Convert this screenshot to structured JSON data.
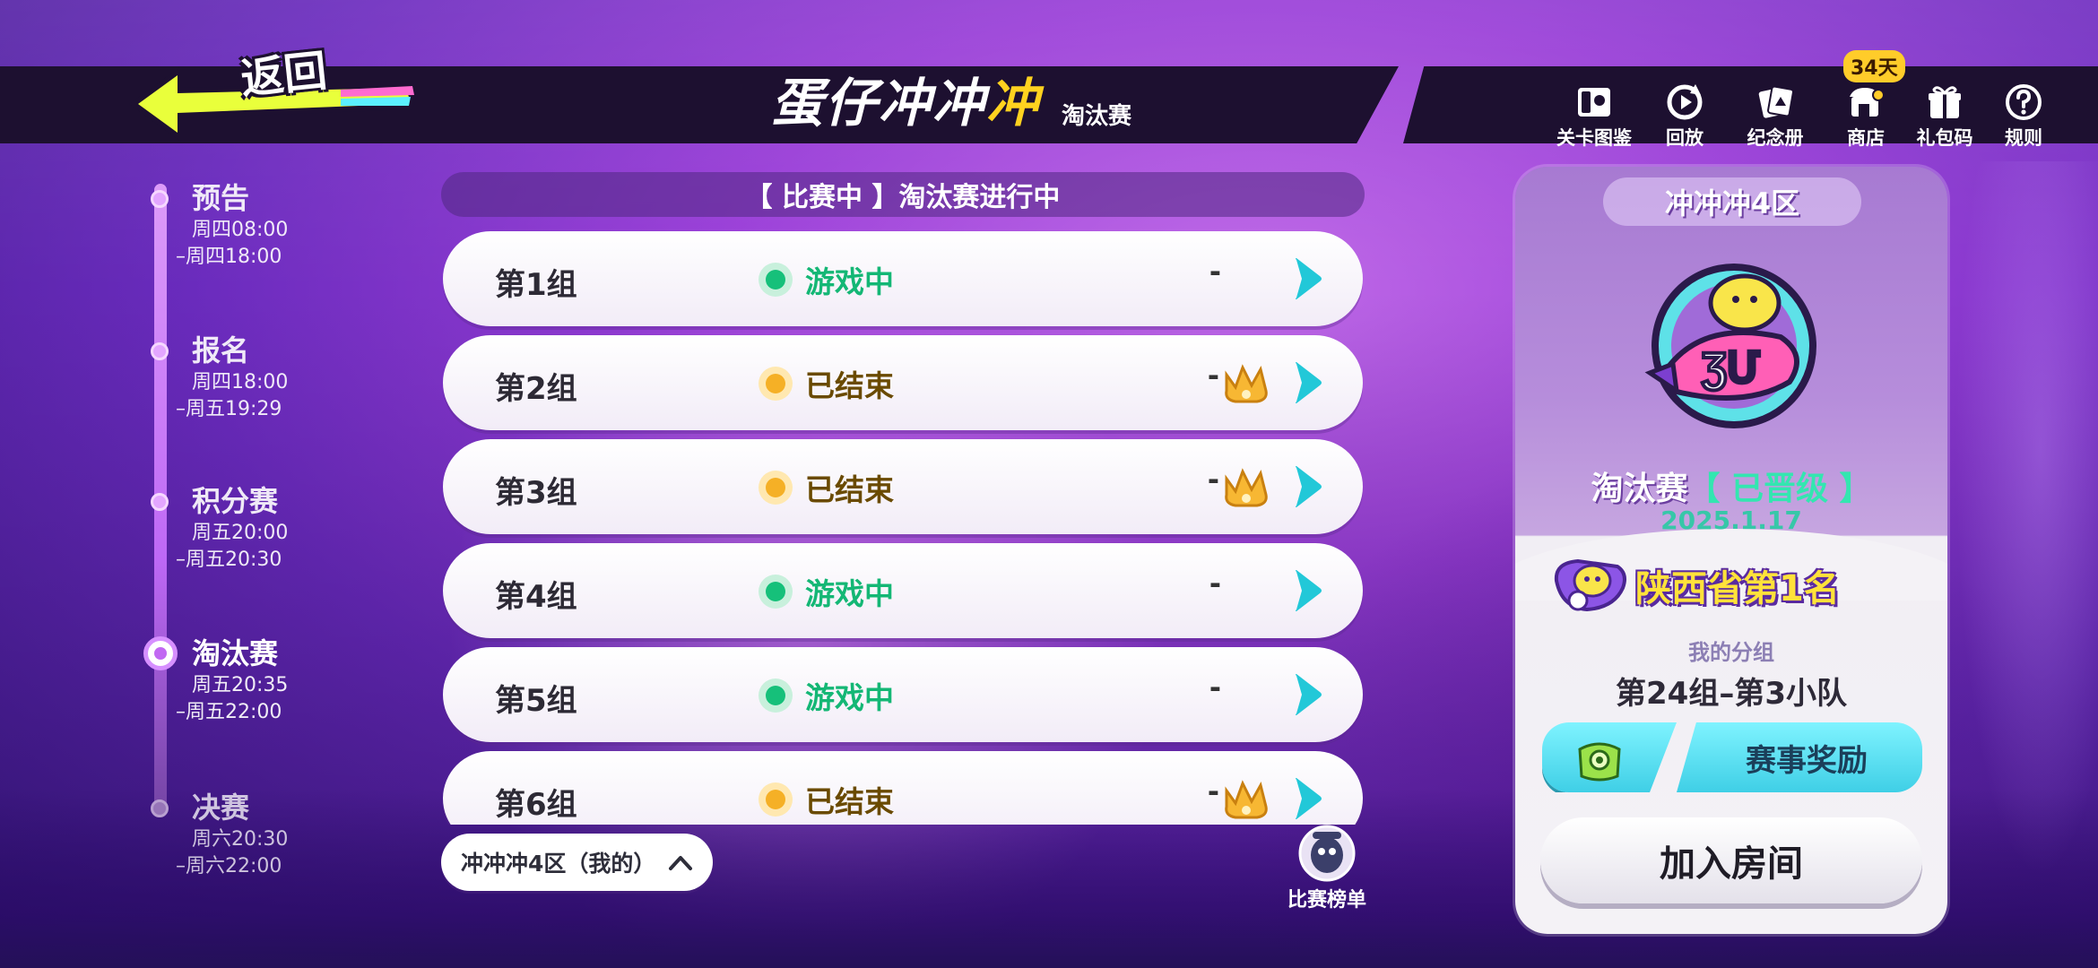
{
  "header": {
    "back_label": "返回",
    "title_part1": "蛋仔冲冲",
    "title_part2": "冲",
    "subtitle": "淘汰赛"
  },
  "toolbar": {
    "items": [
      {
        "label": "关卡图鉴",
        "icon": "level-guide-icon"
      },
      {
        "label": "回放",
        "icon": "replay-icon"
      },
      {
        "label": "纪念册",
        "icon": "album-icon"
      },
      {
        "label": "商店",
        "icon": "shop-icon",
        "badge": "34天"
      },
      {
        "label": "礼包码",
        "icon": "gift-code-icon"
      },
      {
        "label": "规则",
        "icon": "rules-icon"
      }
    ]
  },
  "timeline": {
    "stages": [
      {
        "name": "预告",
        "time_start": "周四08:00",
        "time_end": "–周四18:00",
        "state": "past"
      },
      {
        "name": "报名",
        "time_start": "周四18:00",
        "time_end": "–周五19:29",
        "state": "past"
      },
      {
        "name": "积分赛",
        "time_start": "周五20:00",
        "time_end": "–周五20:30",
        "state": "past"
      },
      {
        "name": "淘汰赛",
        "time_start": "周五20:35",
        "time_end": "–周五22:00",
        "state": "current"
      },
      {
        "name": "决赛",
        "time_start": "周六20:30",
        "time_end": "–周六22:00",
        "state": "future"
      }
    ]
  },
  "match": {
    "status_header": "【 比赛中 】淘汰赛进行中",
    "groups": [
      {
        "name": "第1组",
        "status": "游戏中",
        "status_type": "live",
        "result": "-"
      },
      {
        "name": "第2组",
        "status": "已结束",
        "status_type": "done",
        "result": "-"
      },
      {
        "name": "第3组",
        "status": "已结束",
        "status_type": "done",
        "result": "-"
      },
      {
        "name": "第4组",
        "status": "游戏中",
        "status_type": "live",
        "result": "-"
      },
      {
        "name": "第5组",
        "status": "游戏中",
        "status_type": "live",
        "result": "-"
      },
      {
        "name": "第6组",
        "status": "已结束",
        "status_type": "done",
        "result": "-"
      }
    ],
    "region_tab": "冲冲冲4区（我的）",
    "leaderboard_label": "比赛榜单"
  },
  "card": {
    "region": "冲冲冲4区",
    "tournament_name": "淘汰赛",
    "tournament_status": "【 已晋级 】",
    "date": "2025.1.17",
    "rank_text": "陕西省第1名",
    "my_group_label": "我的分组",
    "my_group_value": "第24组–第3小队",
    "reward_label": "赛事奖励",
    "join_label": "加入房间"
  },
  "colors": {
    "live": "#14b775",
    "done": "#f5b026",
    "accent_yellow": "#ffd21f",
    "accent_cyan": "#3fcfe6",
    "advanced_green": "#33e6b0"
  }
}
